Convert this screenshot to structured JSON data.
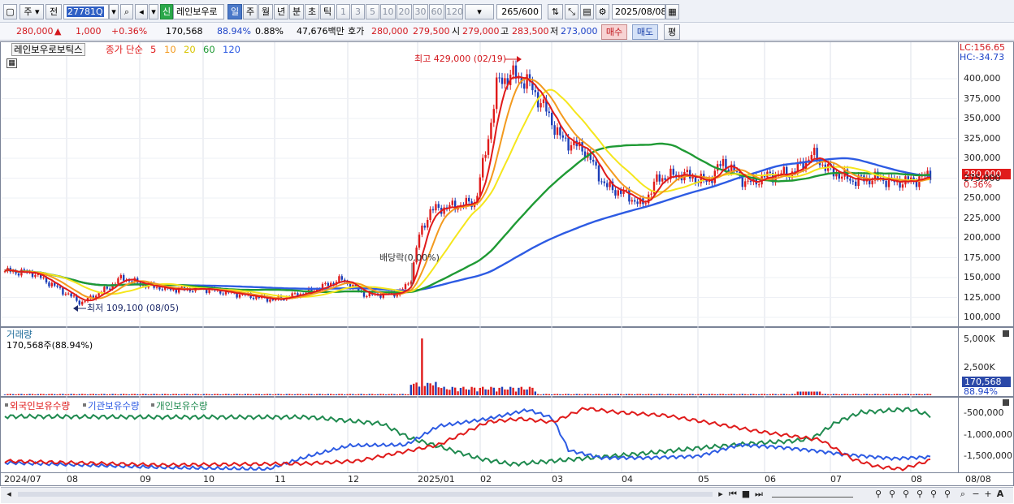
{
  "toolbar": {
    "market": "주",
    "scope": "전",
    "code": "27781Q",
    "name_badge": "신",
    "stock_name": "레인보우로",
    "periods": [
      "일",
      "주",
      "월",
      "년",
      "분",
      "초",
      "틱"
    ],
    "active_period": "일",
    "intervals": [
      "1",
      "3",
      "5",
      "10",
      "20",
      "30",
      "60",
      "120"
    ],
    "count_value": "265",
    "count_max": "/600",
    "date": "2025/08/08"
  },
  "quote": {
    "price": "280,000",
    "change_arrow": "▲",
    "change": "1,000",
    "change_pct": "+0.36%",
    "volume": "170,568",
    "volume_ratio": "88.94%",
    "turnover": "0.88%",
    "amount": "47,676백만",
    "bid_ask_label": "호가",
    "ask": "280,000",
    "bid": "279,500",
    "open_label": "시",
    "open": "279,000",
    "high_label": "고",
    "high": "283,500",
    "low_label": "저",
    "low": "273,000",
    "buy_button": "매수",
    "sell_button": "매도",
    "eval_button": "평"
  },
  "price_pane": {
    "title": "레인보우로보틱스",
    "ma_label": "종가 단순",
    "ma_periods": [
      "5",
      "10",
      "20",
      "60",
      "120"
    ],
    "ma_colors": [
      "#e01b1b",
      "#f39a1e",
      "#f5e61c",
      "#1f9a34",
      "#2d5be3"
    ],
    "lc": "LC:156.65",
    "hc": "HC:-34.73",
    "y_ticks": [
      "400,000",
      "375,000",
      "350,000",
      "325,000",
      "300,000",
      "275,000",
      "250,000",
      "225,000",
      "200,000",
      "175,000",
      "150,000",
      "125,000",
      "100,000"
    ],
    "last_price_box": "280,000",
    "last_change_box": "0.36%",
    "annotation_high": "최고 429,000 (02/19)",
    "annotation_low": "최저 109,100 (08/05)",
    "annotation_dividend": "배당락(0.00%)"
  },
  "volume_pane": {
    "title": "거래량",
    "value_text": "170,568주(88.94%)",
    "y_ticks": [
      "5,000K",
      "2,500K"
    ],
    "box_value": "170,568",
    "box_pct": "88.94%"
  },
  "holdings_pane": {
    "legend": [
      "외국인보유수량",
      "기관보유수량",
      "개인보유수량"
    ],
    "legend_colors": [
      "#e01b1b",
      "#2d5be3",
      "#1f8a4f"
    ],
    "y_ticks": [
      "-500,000",
      "-1,000,000",
      "-1,500,000"
    ]
  },
  "x_axis": [
    "2024/07",
    "08",
    "09",
    "10",
    "11",
    "12",
    "2025/01",
    "02",
    "03",
    "04",
    "05",
    "06",
    "07",
    "08",
    "08/08"
  ],
  "chart_data": [
    {
      "type": "candlestick",
      "title": "레인보우로보틱스",
      "ylim": [
        100000,
        430000
      ],
      "x": [
        "2024/07",
        "08",
        "09",
        "10",
        "11",
        "12",
        "2025/01",
        "02",
        "03",
        "04",
        "05",
        "06",
        "07",
        "08"
      ],
      "close_approx": [
        155000,
        125000,
        145000,
        135000,
        125000,
        140000,
        235000,
        395000,
        310000,
        255000,
        280000,
        285000,
        275000,
        280000
      ],
      "moving_averages": [
        "5",
        "10",
        "20",
        "60",
        "120"
      ],
      "last": 280000
    },
    {
      "type": "bar",
      "title": "거래량",
      "ylim": [
        0,
        6000000
      ],
      "last": 170568
    },
    {
      "type": "line",
      "series": [
        {
          "name": "외국인보유수량"
        },
        {
          "name": "기관보유수량"
        },
        {
          "name": "개인보유수량"
        }
      ]
    }
  ]
}
